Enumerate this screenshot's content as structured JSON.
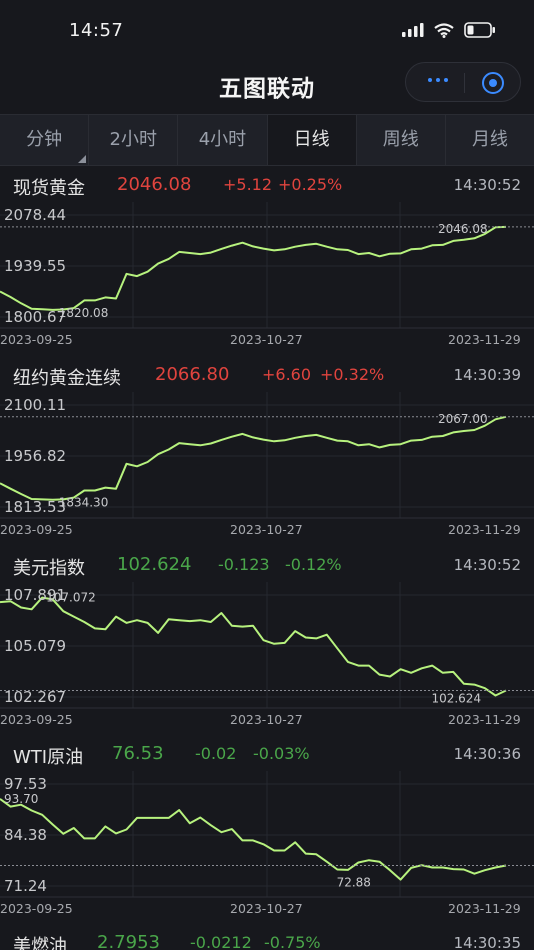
{
  "status_bar": {
    "time": "14:57"
  },
  "header": {
    "title": "五图联动"
  },
  "colors": {
    "up": "#e0443e",
    "down": "#4aa64a",
    "line": "#b7f27e",
    "background": "#17181d"
  },
  "tabs": [
    {
      "label": "分钟",
      "active": false
    },
    {
      "label": "2小时",
      "active": false
    },
    {
      "label": "4小时",
      "active": false
    },
    {
      "label": "日线",
      "active": true
    },
    {
      "label": "周线",
      "active": false
    },
    {
      "label": "月线",
      "active": false
    }
  ],
  "panels": [
    {
      "name": "现货黄金",
      "price": "2046.08",
      "change": "+5.12",
      "pct": "+0.25%",
      "time": "14:30:52",
      "direction": "up",
      "y_labels": [
        "2078.44",
        "1939.55",
        "1800.67"
      ],
      "dates": [
        "2023-09-25",
        "2023-10-27",
        "2023-11-29"
      ],
      "max_label": "2046.08",
      "min_label": "1820.08"
    },
    {
      "name": "纽约黄金连续",
      "price": "2066.80",
      "change": "+6.60",
      "pct": "+0.32%",
      "time": "14:30:39",
      "direction": "up",
      "y_labels": [
        "2100.11",
        "1956.82",
        "1813.53"
      ],
      "dates": [
        "2023-09-25",
        "2023-10-27",
        "2023-11-29"
      ],
      "max_label": "2067.00",
      "min_label": "1834.30"
    },
    {
      "name": "美元指数",
      "price": "102.624",
      "change": "-0.123",
      "pct": "-0.12%",
      "time": "14:30:52",
      "direction": "down",
      "y_labels": [
        "107.891",
        "105.079",
        "102.267"
      ],
      "dates": [
        "2023-09-25",
        "2023-10-27",
        "2023-11-29"
      ],
      "max_label": "107.072",
      "min_label": "102.624"
    },
    {
      "name": "WTI原油",
      "price": "76.53",
      "change": "-0.02",
      "pct": "-0.03%",
      "time": "14:30:36",
      "direction": "down",
      "y_labels": [
        "97.53",
        "84.38",
        "71.24"
      ],
      "dates": [
        "2023-09-25",
        "2023-10-27",
        "2023-11-29"
      ],
      "max_label": "93.70",
      "min_label": "72.88"
    },
    {
      "name": "美燃油",
      "price": "2.7953",
      "change": "-0.0212",
      "pct": "-0.75%",
      "time": "14:30:35",
      "direction": "down"
    }
  ],
  "chart_data": [
    {
      "type": "line",
      "title": "现货黄金",
      "ylim": [
        1800.67,
        2078.44
      ],
      "values": [
        1870,
        1855,
        1838,
        1823,
        1822,
        1820,
        1821,
        1825,
        1846,
        1846,
        1854,
        1851,
        1918,
        1912,
        1924,
        1946,
        1959,
        1978,
        1975,
        1972,
        1976,
        1986,
        1995,
        2003,
        1993,
        1987,
        1982,
        1985,
        1992,
        1997,
        2000,
        1992,
        1985,
        1983,
        1972,
        1975,
        1966,
        1973,
        1974,
        1985,
        1987,
        1996,
        1997,
        2008,
        2011,
        2015,
        2027,
        2045,
        2046.08
      ]
    },
    {
      "type": "line",
      "title": "纽约黄金连续",
      "ylim": [
        1813.53,
        2100.11
      ],
      "values": [
        1880,
        1865,
        1850,
        1836,
        1835,
        1834,
        1835,
        1840,
        1860,
        1860,
        1868,
        1865,
        1935,
        1928,
        1940,
        1962,
        1975,
        1993,
        1990,
        1987,
        1992,
        2002,
        2011,
        2019,
        2009,
        2003,
        1998,
        2001,
        2008,
        2013,
        2016,
        2008,
        2000,
        1998,
        1987,
        1990,
        1981,
        1988,
        1990,
        2000,
        2002,
        2011,
        2013,
        2023,
        2027,
        2030,
        2042,
        2060,
        2067
      ]
    },
    {
      "type": "line",
      "title": "美元指数",
      "ylim": [
        102.267,
        107.891
      ],
      "values": [
        107.5,
        107.55,
        107.2,
        107.1,
        107.75,
        107.65,
        107.0,
        106.7,
        106.4,
        106.05,
        106.0,
        106.7,
        106.35,
        106.5,
        106.35,
        105.8,
        106.55,
        106.5,
        106.45,
        106.5,
        106.4,
        106.9,
        106.2,
        106.15,
        106.2,
        105.4,
        105.2,
        105.25,
        105.9,
        105.55,
        105.5,
        105.7,
        104.95,
        104.2,
        104.0,
        104.0,
        103.5,
        103.4,
        103.8,
        103.6,
        103.85,
        104.0,
        103.6,
        103.65,
        103.0,
        102.95,
        102.75,
        102.35,
        102.624
      ]
    },
    {
      "type": "line",
      "title": "WTI原油",
      "ylim": [
        71.24,
        97.53
      ],
      "values": [
        93.7,
        91.7,
        92.2,
        90.7,
        89.6,
        87.1,
        84.7,
        86.2,
        83.5,
        83.5,
        86.6,
        84.8,
        85.8,
        88.8,
        88.8,
        88.8,
        88.8,
        90.8,
        87.4,
        88.9,
        86.9,
        85.1,
        85.9,
        83.0,
        83.0,
        82.0,
        80.4,
        80.4,
        82.5,
        79.6,
        79.4,
        77.5,
        75.5,
        75.4,
        77.3,
        77.9,
        77.5,
        75.3,
        72.88,
        75.9,
        76.6,
        76.0,
        76.0,
        75.6,
        75.5,
        74.4,
        75.3,
        76.0,
        76.53
      ]
    }
  ]
}
